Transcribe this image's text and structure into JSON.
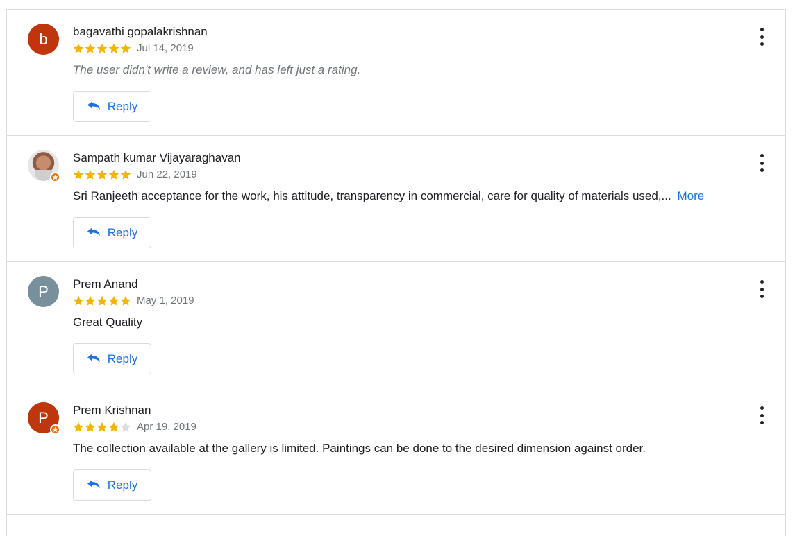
{
  "colors": {
    "star_filled": "#f4b400",
    "star_empty": "#dadce0",
    "link": "#1a73e8",
    "avatar_b": "#bf360c",
    "avatar_p_grey": "#78909c",
    "avatar_p_orange": "#bf360c"
  },
  "reviews": [
    {
      "author": "bagavathi gopalakrishnan",
      "avatar_letter": "b",
      "avatar_color": "#bf360c",
      "rating": 5,
      "date": "Jul 14, 2019",
      "text": "The user didn't write a review, and has left just a rating.",
      "reply_label": "Reply"
    },
    {
      "author": "Sampath kumar Vijayaraghavan",
      "avatar_letter": "",
      "rating": 5,
      "date": "Jun 22, 2019",
      "text": "Sri Ranjeeth acceptance for the work, his attitude, transparency in commercial, care for quality of materials used,...",
      "more_label": "More",
      "reply_label": "Reply"
    },
    {
      "author": "Prem Anand",
      "avatar_letter": "P",
      "avatar_color": "#78909c",
      "rating": 5,
      "date": "May 1, 2019",
      "text": "Great Quality",
      "reply_label": "Reply"
    },
    {
      "author": "Prem Krishnan",
      "avatar_letter": "P",
      "avatar_color": "#bf360c",
      "rating": 4,
      "date": "Apr 19, 2019",
      "text": "The collection available at the gallery is limited. Paintings can be done to the desired dimension against order.",
      "reply_label": "Reply"
    }
  ]
}
